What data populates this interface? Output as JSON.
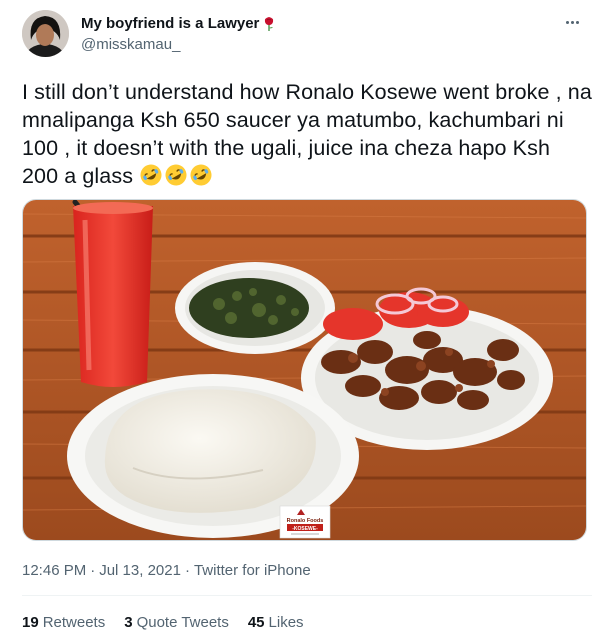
{
  "user": {
    "display_name": "My boyfriend is a Lawyer",
    "handle": "@misskamau_"
  },
  "tweet": {
    "text": "I still don’t understand how Ronalo Kosewe went broke , na mnalipanga Ksh 650 saucer ya matumbo, kachumbari ni 100 , it doesn’t with the ugali, juice ina cheza hapo Ksh 200 a glass",
    "emoji_icons": [
      "rolling-on-floor-laughing-icon",
      "rolling-on-floor-laughing-icon",
      "rolling-on-floor-laughing-icon"
    ]
  },
  "photo": {
    "logo_line1": "Ronalo Foods",
    "logo_line2": "-KOSEWE-"
  },
  "meta": {
    "time": "12:46 PM",
    "date": "Jul 13, 2021",
    "source": "Twitter for iPhone"
  },
  "stats": {
    "retweets_count": "19",
    "retweets_label": "Retweets",
    "quotes_count": "3",
    "quotes_label": "Quote Tweets",
    "likes_count": "45",
    "likes_label": "Likes"
  },
  "colors": {
    "text": "#0f1419",
    "secondary": "#536471",
    "divider": "#eff3f4"
  }
}
